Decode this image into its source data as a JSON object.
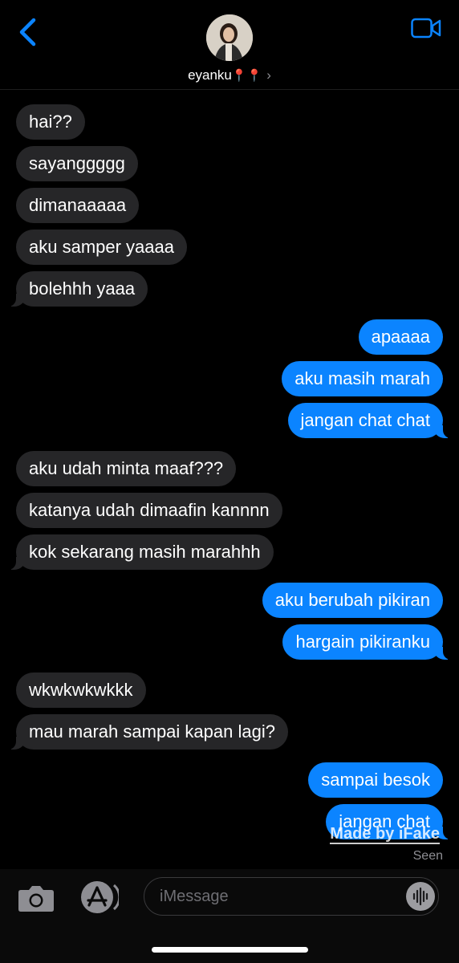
{
  "header": {
    "contact_name": "eyanku",
    "contact_pins": "📍📍",
    "chevron": "›",
    "back_icon": "chevron-left-icon",
    "video_icon": "video-camera-icon",
    "accent_color": "#0b84ff"
  },
  "messages": [
    {
      "direction": "incoming",
      "text": "hai??"
    },
    {
      "direction": "incoming",
      "text": "sayanggggg"
    },
    {
      "direction": "incoming",
      "text": "dimanaaaaa"
    },
    {
      "direction": "incoming",
      "text": "aku samper yaaaa"
    },
    {
      "direction": "incoming",
      "text": "bolehhh yaaa"
    },
    {
      "direction": "outgoing",
      "text": "apaaaa"
    },
    {
      "direction": "outgoing",
      "text": "aku masih marah"
    },
    {
      "direction": "outgoing",
      "text": "jangan chat chat"
    },
    {
      "direction": "incoming",
      "text": "aku udah minta maaf???"
    },
    {
      "direction": "incoming",
      "text": "katanya udah dimaafin kannnn"
    },
    {
      "direction": "incoming",
      "text": "kok sekarang masih marahhh"
    },
    {
      "direction": "outgoing",
      "text": "aku berubah pikiran"
    },
    {
      "direction": "outgoing",
      "text": "hargain pikiranku"
    },
    {
      "direction": "incoming",
      "text": "wkwkwkwkkk"
    },
    {
      "direction": "incoming",
      "text": "mau marah sampai kapan lagi?"
    },
    {
      "direction": "outgoing",
      "text": "sampai besok"
    },
    {
      "direction": "outgoing",
      "text": "jangan chat"
    }
  ],
  "watermark": "Made by iFake",
  "seen_label": "Seen",
  "input": {
    "placeholder": "iMessage",
    "camera_icon": "camera-icon",
    "appstore_icon": "app-store-icon",
    "audio_icon": "audio-waveform-icon"
  }
}
